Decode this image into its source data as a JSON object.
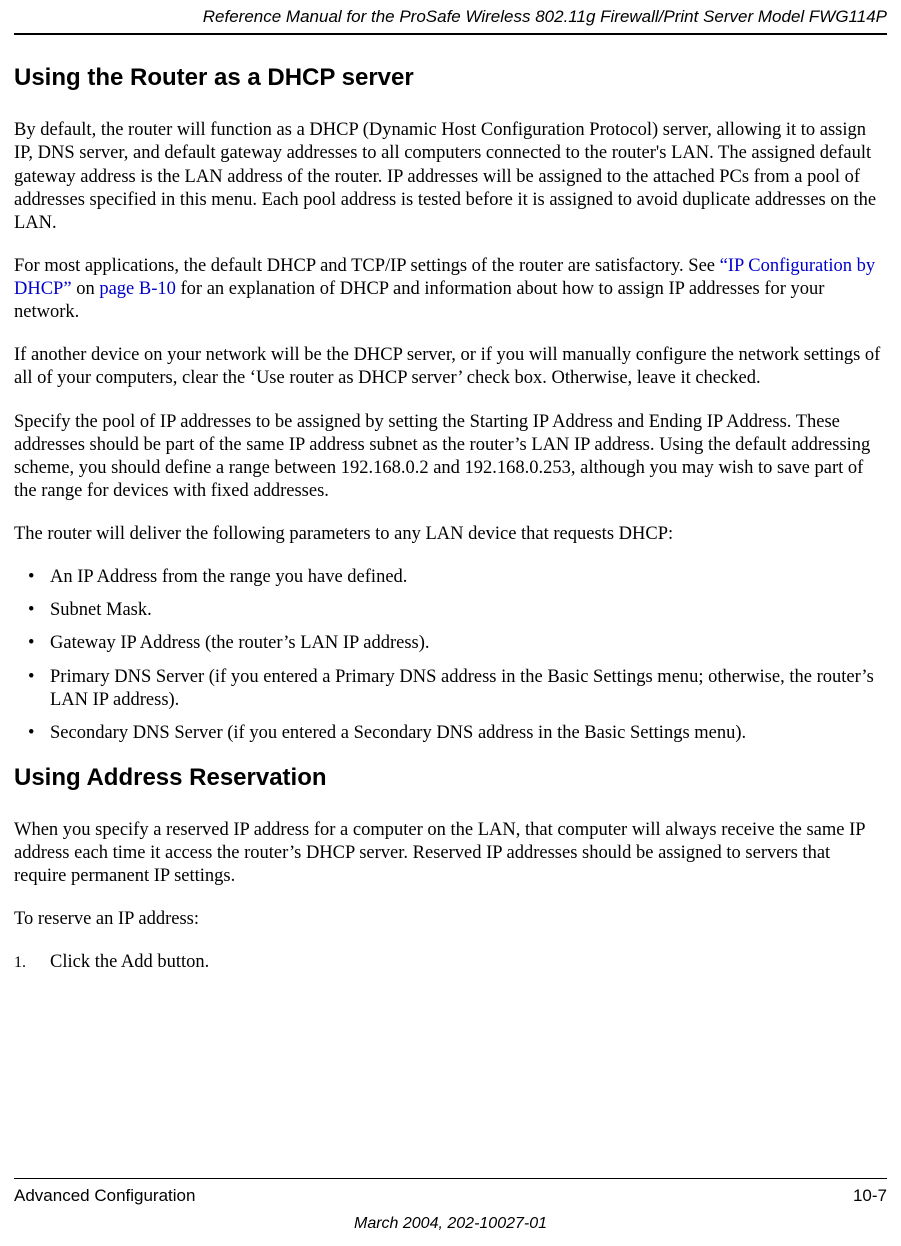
{
  "header": {
    "running_title": "Reference Manual for the ProSafe Wireless 802.11g  Firewall/Print Server Model FWG114P"
  },
  "section1": {
    "heading": "Using the Router as a DHCP server",
    "p1": "By default, the router will function as a DHCP (Dynamic Host Configuration Protocol) server, allowing it to assign IP, DNS server, and default gateway addresses to all computers connected to the router's LAN. The assigned default gateway address is the LAN address of the router. IP addresses will be assigned to the attached PCs from a pool of addresses specified in this menu. Each pool address is tested before it is assigned to avoid duplicate addresses on the LAN.",
    "p2_pre": "For most applications, the default DHCP and TCP/IP settings of the router are satisfactory. See ",
    "p2_link1": "“IP Configuration by DHCP”",
    "p2_mid": " on ",
    "p2_link2": "page B-10",
    "p2_post": " for an explanation of DHCP and information about how to assign IP addresses for your network.",
    "p3": "If another device on your network will be the DHCP server, or if you will manually configure the network settings of all of your computers, clear the ‘Use router as DHCP server’ check box. Otherwise, leave it checked.",
    "p4": "Specify the pool of IP addresses to be assigned by setting the Starting IP Address and Ending IP Address. These addresses should be part of the same IP address subnet as the router’s LAN IP address. Using the default addressing scheme, you should define a range between 192.168.0.2 and 192.168.0.253, although you may wish to save part of the range for devices with fixed addresses.",
    "p5": "The router will deliver the following parameters to any LAN device that requests DHCP:",
    "bullets": [
      "An IP Address from the range you have defined.",
      "Subnet Mask.",
      "Gateway IP Address (the router’s LAN IP address).",
      "Primary DNS Server (if you entered a Primary DNS address in the Basic Settings menu; otherwise, the router’s LAN IP address).",
      "Secondary DNS Server (if you entered a Secondary DNS address in the Basic Settings menu)."
    ]
  },
  "section2": {
    "heading": "Using Address Reservation",
    "p1": "When you specify a reserved IP address for a computer on the LAN, that computer will always receive the same IP address each time it access the router’s DHCP server. Reserved IP addresses should be assigned to servers that require permanent IP settings.",
    "p2": "To reserve an IP address:",
    "steps": [
      {
        "num": "1.",
        "text": "Click the Add button."
      }
    ]
  },
  "footer": {
    "left": "Advanced Configuration",
    "right": "10-7",
    "center": "March 2004, 202-10027-01"
  }
}
